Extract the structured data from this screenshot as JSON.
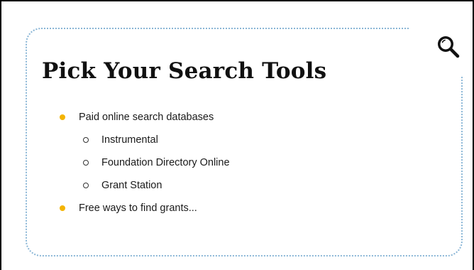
{
  "slide": {
    "title": "Pick Your Search Tools",
    "icon": "search-icon",
    "accent_color": "#f4b400",
    "frame_color": "#8ab6d6",
    "bullets": [
      {
        "level": 1,
        "text": "Paid online search databases"
      },
      {
        "level": 2,
        "text": "Instrumental"
      },
      {
        "level": 2,
        "text": "Foundation Directory Online"
      },
      {
        "level": 2,
        "text": "Grant Station"
      },
      {
        "level": 1,
        "text": "Free ways to find grants..."
      }
    ]
  }
}
